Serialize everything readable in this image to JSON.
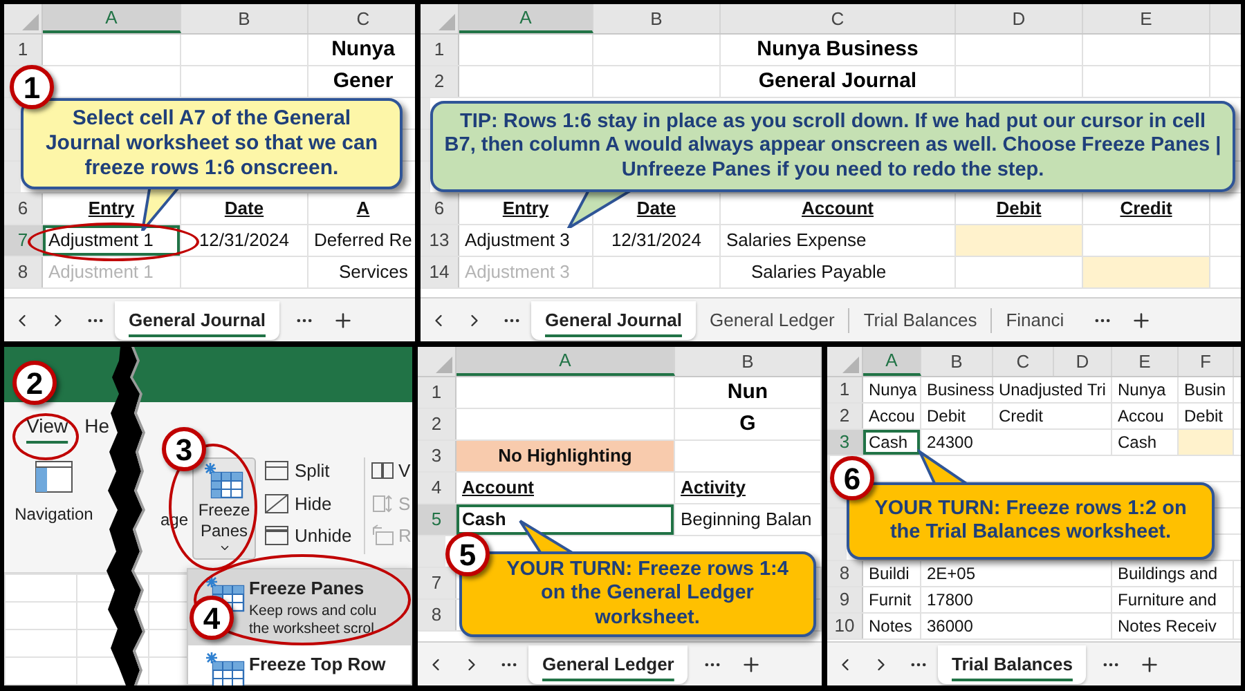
{
  "panels": [
    {
      "kind": "sheet",
      "step": "1",
      "columns": [
        {
          "label": "A",
          "selected": true
        },
        {
          "label": "B",
          "selected": false
        },
        {
          "label": "C",
          "selected": false
        }
      ],
      "rows": [
        {
          "num": "1",
          "selected": false,
          "cells": [
            null,
            null,
            {
              "kind": "title",
              "text": "Nunya"
            }
          ]
        },
        {
          "selected": false,
          "cells": [
            null,
            null,
            {
              "kind": "title",
              "text": "Gener"
            }
          ]
        },
        {
          "kind": "covered"
        },
        {
          "kind": "covered"
        },
        {
          "kind": "covered"
        },
        {
          "num": "6",
          "selected": false,
          "cells": [
            {
              "kind": "header",
              "text": "Entry"
            },
            {
              "kind": "header",
              "text": "Date"
            },
            {
              "kind": "header",
              "text": "A"
            }
          ]
        },
        {
          "num": "7",
          "selected": true,
          "cells": [
            {
              "kind": "text",
              "text": "Adjustment 1"
            },
            {
              "kind": "center",
              "text": "12/31/2024"
            },
            {
              "kind": "text",
              "text": "Deferred Re"
            }
          ]
        },
        {
          "num": "8",
          "selected": false,
          "cells": [
            {
              "kind": "faded",
              "text": "Adjustment 1"
            },
            null,
            {
              "kind": "indent",
              "text": "Services"
            }
          ]
        }
      ],
      "tabs": [
        {
          "label": "General Journal",
          "selected": true
        }
      ],
      "callout": {
        "kind": "note",
        "text": "Select cell A7 of the General Journal worksheet so that we can freeze rows 1:6 onscreen."
      }
    },
    {
      "kind": "sheet",
      "columns": [
        {
          "label": "A",
          "selected": true
        },
        {
          "label": "B",
          "selected": false
        },
        {
          "label": "C",
          "selected": false
        },
        {
          "label": "D",
          "selected": false
        },
        {
          "label": "E",
          "selected": false
        }
      ],
      "rows": [
        {
          "num": "1",
          "selected": false,
          "cells": [
            null,
            null,
            {
              "kind": "title",
              "text": "Nunya Business"
            },
            null,
            null
          ]
        },
        {
          "num": "2",
          "selected": false,
          "cells": [
            null,
            null,
            {
              "kind": "title",
              "text": "General Journal"
            },
            null,
            null
          ]
        },
        {
          "kind": "covered"
        },
        {
          "kind": "covered"
        },
        {
          "kind": "covered"
        },
        {
          "num": "6",
          "selected": false,
          "cells": [
            {
              "kind": "header",
              "text": "Entry"
            },
            {
              "kind": "header",
              "text": "Date"
            },
            {
              "kind": "header",
              "text": "Account"
            },
            {
              "kind": "header",
              "text": "Debit"
            },
            {
              "kind": "header",
              "text": "Credit"
            }
          ]
        },
        {
          "num": "13",
          "selected": false,
          "cells": [
            {
              "kind": "text",
              "text": "Adjustment 3"
            },
            {
              "kind": "center",
              "text": "12/31/2024"
            },
            {
              "kind": "text",
              "text": "Salaries Expense"
            },
            {
              "kind": "input"
            },
            null
          ]
        },
        {
          "num": "14",
          "selected": false,
          "cells": [
            {
              "kind": "faded",
              "text": "Adjustment 3"
            },
            null,
            {
              "kind": "indent",
              "text": "Salaries Payable"
            },
            null,
            {
              "kind": "input"
            }
          ]
        }
      ],
      "tabs": [
        {
          "label": "General Journal",
          "selected": true
        },
        {
          "label": "General Ledger",
          "selected": false
        },
        {
          "label": "Trial Balances",
          "selected": false
        },
        {
          "label": "Financi",
          "selected": false
        }
      ],
      "callout": {
        "kind": "tip",
        "text": "TIP: Rows 1:6 stay in place as you scroll down. If we had put our cursor in cell B7, then column A would always appear onscreen as well. Choose Freeze Panes | Unfreeze Panes if you need to redo the step."
      }
    },
    {
      "kind": "ribbon",
      "steps": [
        "2",
        "3",
        "4"
      ],
      "tabs": [
        {
          "label": "View",
          "selected": true
        },
        {
          "label": "He",
          "selected": false
        }
      ],
      "navigation": {
        "label": "Navigation"
      },
      "cut_label": "age",
      "freeze_button": {
        "label": "Freeze Panes",
        "selected": true
      },
      "window_buttons": [
        {
          "kind": "split",
          "label": "Split",
          "disabled": false
        },
        {
          "kind": "hide",
          "label": "Hide",
          "disabled": false
        },
        {
          "kind": "unhide",
          "label": "Unhide",
          "disabled": false
        }
      ],
      "view_buttons": [
        {
          "kind": "pages",
          "label": "V",
          "disabled": false
        },
        {
          "kind": "sync",
          "label": "S",
          "disabled": true
        },
        {
          "kind": "reset",
          "label": "R",
          "disabled": true
        }
      ],
      "menu": [
        {
          "kind": "freeze_panes",
          "label": "Freeze Panes",
          "description": [
            "Keep rows and colu",
            "the worksheet scrol"
          ],
          "selected": true
        },
        {
          "kind": "freeze_top_row",
          "label": "Freeze Top Row",
          "selected": false
        }
      ]
    },
    {
      "kind": "sheet",
      "step": "5",
      "columns": [
        {
          "label": "A",
          "selected": true
        },
        {
          "label": "B",
          "selected": false
        }
      ],
      "rows": [
        {
          "num": "1",
          "selected": false,
          "cells": [
            null,
            {
              "kind": "title",
              "text": "Nun"
            }
          ]
        },
        {
          "num": "2",
          "selected": false,
          "cells": [
            null,
            {
              "kind": "title",
              "text": "G"
            }
          ]
        },
        {
          "num": "3",
          "selected": false,
          "cells": [
            {
              "kind": "banner",
              "text": "No Highlighting"
            },
            null
          ]
        },
        {
          "num": "4",
          "selected": false,
          "cells": [
            {
              "kind": "label",
              "text": "Account"
            },
            {
              "kind": "label",
              "text": "Activity"
            }
          ]
        },
        {
          "num": "5",
          "selected": true,
          "cells": [
            {
              "kind": "strong",
              "text": "Cash"
            },
            {
              "kind": "text",
              "text": "Beginning Balan"
            }
          ]
        },
        {
          "kind": "covered"
        },
        {
          "num": "7",
          "selected": false
        },
        {
          "num": "8",
          "selected": false
        }
      ],
      "tabs": [
        {
          "label": "General Ledger",
          "selected": true
        }
      ],
      "callout": {
        "kind": "task",
        "text": "YOUR TURN: Freeze rows 1:4 on the General Ledger worksheet."
      }
    },
    {
      "kind": "sheet",
      "step": "6",
      "columns": [
        {
          "label": "A",
          "selected": true
        },
        {
          "label": "B",
          "selected": false
        },
        {
          "label": "C",
          "selected": false
        },
        {
          "label": "D",
          "selected": false
        },
        {
          "label": "E",
          "selected": false
        },
        {
          "label": "F",
          "selected": false
        }
      ],
      "rows": [
        {
          "num": "1",
          "selected": false,
          "cells": [
            {
              "kind": "text",
              "text": "Nunya"
            },
            {
              "kind": "text",
              "text": "Business"
            },
            {
              "kind": "text",
              "text": "Unadjusted Tri"
            },
            null,
            {
              "kind": "text",
              "text": "Nunya"
            },
            {
              "kind": "text",
              "text": "Busin"
            }
          ]
        },
        {
          "num": "2",
          "selected": false,
          "cells": [
            {
              "kind": "text",
              "text": "Accou"
            },
            {
              "kind": "text",
              "text": "Debit"
            },
            {
              "kind": "text",
              "text": "Credit"
            },
            null,
            {
              "kind": "text",
              "text": "Accou"
            },
            {
              "kind": "text",
              "text": "Debit"
            }
          ]
        },
        {
          "num": "3",
          "selected": true,
          "cells": [
            {
              "kind": "text",
              "text": "Cash"
            },
            {
              "kind": "text",
              "text": "24300"
            },
            null,
            null,
            {
              "kind": "text",
              "text": "Cash"
            },
            {
              "kind": "input"
            }
          ]
        },
        {
          "kind": "covered"
        },
        {
          "kind": "covered"
        },
        {
          "kind": "covered"
        },
        {
          "kind": "covered"
        },
        {
          "num": "8",
          "selected": false,
          "cells": [
            {
              "kind": "text",
              "text": "Buildi"
            },
            {
              "kind": "text",
              "text": "2E+05"
            },
            null,
            null,
            {
              "kind": "text",
              "text": "Buildings and"
            },
            null
          ]
        },
        {
          "num": "9",
          "selected": false,
          "cells": [
            {
              "kind": "text",
              "text": "Furnit"
            },
            {
              "kind": "text",
              "text": "17800"
            },
            null,
            null,
            {
              "kind": "text",
              "text": "Furniture and"
            },
            null
          ]
        },
        {
          "num": "10",
          "selected": false,
          "cells": [
            {
              "kind": "text",
              "text": "Notes"
            },
            {
              "kind": "text",
              "text": "36000"
            },
            null,
            null,
            {
              "kind": "text",
              "text": "Notes Receiv"
            },
            null
          ]
        }
      ],
      "tabs": [
        {
          "label": "Trial Balances",
          "selected": true
        }
      ],
      "callout": {
        "kind": "task",
        "text": "YOUR TURN: Freeze rows 1:2 on the Trial Balances worksheet."
      }
    }
  ]
}
